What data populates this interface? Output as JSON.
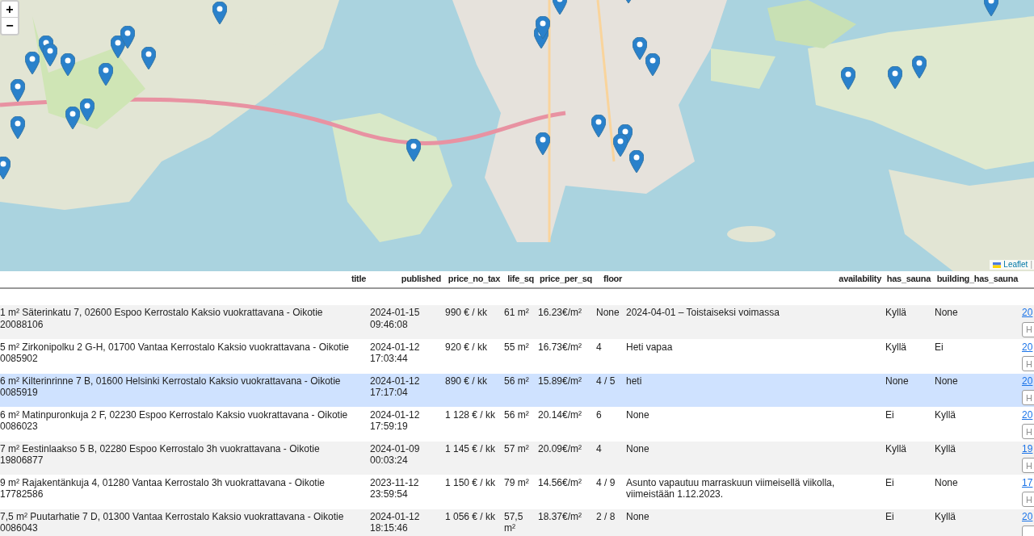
{
  "map": {
    "zoom_in": "+",
    "zoom_out": "−",
    "attribution": "Leaflet",
    "attribution_separator": "|"
  },
  "table": {
    "columns": [
      "title",
      "published",
      "price_no_tax",
      "life_sq",
      "price_per_sq",
      "floor",
      "availability",
      "has_sauna",
      "building_has_sauna"
    ],
    "rows": [
      {
        "highlighted": false,
        "cells": [
          "1 m² Säterinkatu 7, 02600 Espoo Kerrostalo Kaksio vuokrattavana - Oikotie 20088106",
          "2024-01-15 09:46:08",
          "990 € / kk",
          "61 m²",
          "16.23€/m²",
          "None",
          "2024-04-01 – Toistaiseksi voimassa",
          "Kyllä",
          "None"
        ],
        "link": "20",
        "input_placeholder": "H"
      },
      {
        "highlighted": false,
        "cells": [
          "5 m² Zirkonipolku 2 G-H, 01700 Vantaa Kerrostalo Kaksio vuokrattavana - Oikotie 0085902",
          "2024-01-12 17:03:44",
          "920 € / kk",
          "55 m²",
          "16.73€/m²",
          "4",
          "Heti vapaa",
          "Kyllä",
          "Ei"
        ],
        "link": "20",
        "input_placeholder": "H"
      },
      {
        "highlighted": true,
        "cells": [
          "6 m² Kilterinrinne 7 B, 01600 Helsinki Kerrostalo Kaksio vuokrattavana - Oikotie 0085919",
          "2024-01-12 17:17:04",
          "890 € / kk",
          "56 m²",
          "15.89€/m²",
          "4 / 5",
          "heti",
          "None",
          "None"
        ],
        "link": "20",
        "input_placeholder": "H"
      },
      {
        "highlighted": false,
        "cells": [
          "6 m² Matinpuronkuja 2 F, 02230 Espoo Kerrostalo Kaksio vuokrattavana - Oikotie 0086023",
          "2024-01-12 17:59:19",
          "1 128 € / kk",
          "56 m²",
          "20.14€/m²",
          "6",
          "None",
          "Ei",
          "Kyllä"
        ],
        "link": "20",
        "input_placeholder": "H"
      },
      {
        "highlighted": false,
        "cells": [
          "7 m² Eestinlaakso 5 B, 02280 Espoo Kerrostalo 3h vuokrattavana - Oikotie 19806877",
          "2024-01-09 00:03:24",
          "1 145 € / kk",
          "57 m²",
          "20.09€/m²",
          "4",
          "None",
          "Kyllä",
          "Kyllä"
        ],
        "link": "19",
        "input_placeholder": "H"
      },
      {
        "highlighted": false,
        "cells": [
          "9 m² Rajakentänkuja 4, 01280 Vantaa Kerrostalo 3h vuokrattavana - Oikotie 17782586",
          "2023-11-12 23:59:54",
          "1 150 € / kk",
          "79 m²",
          "14.56€/m²",
          "4 / 9",
          "Asunto vapautuu marraskuun viimeisellä viikolla, viimeistään 1.12.2023.",
          "Ei",
          "None"
        ],
        "link": "17",
        "input_placeholder": "H"
      },
      {
        "highlighted": false,
        "cells": [
          "7,5 m² Puutarhatie 7 D, 01300 Vantaa Kerrostalo Kaksio vuokrattavana - Oikotie 0086043",
          "2024-01-12 18:15:46",
          "1 056 € / kk",
          "57,5 m²",
          "18.37€/m²",
          "2 / 8",
          "None",
          "Ei",
          "Kyllä"
        ],
        "link": "20"
      }
    ]
  }
}
